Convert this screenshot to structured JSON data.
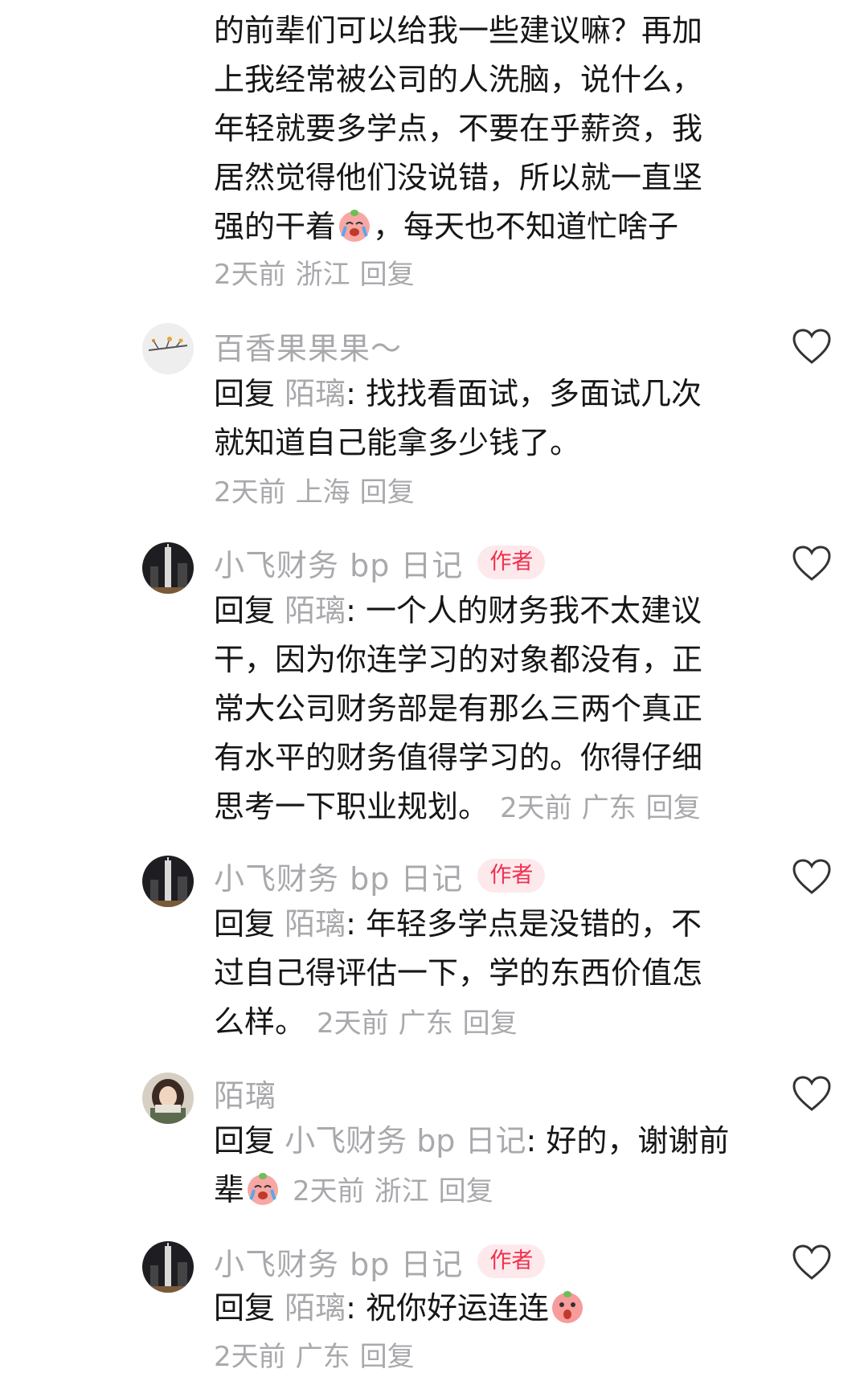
{
  "partial_comment": {
    "lines": [
      "的前辈们可以给我一些建议嘛？再加",
      "上我经常被公司的人洗脑，说什么，",
      "年轻就要多学点，不要在乎薪资，我",
      "居然觉得他们没说错，所以就一直坚",
      "强的干着"
    ],
    "emoji": "crying-emoji",
    "tail_text": "，每天也不知道忙啥子",
    "time": "2天前",
    "location": "浙江",
    "reply_label": "回复"
  },
  "comments": [
    {
      "name": "百香果果果～",
      "is_author": false,
      "reply_prefix": "回复",
      "reply_target": "陌璃",
      "lines": [
        "找找看面试，多面试几次",
        "就知道自己能拿多少钱了。"
      ],
      "time": "2天前",
      "location": "上海",
      "reply_label": "回复"
    },
    {
      "name": "小飞财务 bp 日记",
      "is_author": true,
      "author_badge": "作者",
      "reply_prefix": "回复",
      "reply_target": "陌璃",
      "lines": [
        "一个人的财务我不太建议",
        "干，因为你连学习的对象都没有，正",
        "常大公司财务部是有那么三两个真正",
        "有水平的财务值得学习的。你得仔细",
        "思考一下职业规划。"
      ],
      "time": "2天前",
      "location": "广东",
      "reply_label": "回复"
    },
    {
      "name": "小飞财务 bp 日记",
      "is_author": true,
      "author_badge": "作者",
      "reply_prefix": "回复",
      "reply_target": "陌璃",
      "lines": [
        "年轻多学点是没错的，不",
        "过自己得评估一下，学的东西价值怎",
        "么样。"
      ],
      "time": "2天前",
      "location": "广东",
      "reply_label": "回复"
    },
    {
      "name": "陌璃",
      "is_author": false,
      "reply_prefix": "回复",
      "reply_target": "小飞财务 bp 日记",
      "lines": [
        "好的，谢谢前",
        "辈"
      ],
      "emoji": "crying-emoji",
      "time": "2天前",
      "location": "浙江",
      "reply_label": "回复"
    },
    {
      "name": "小飞财务 bp 日记",
      "is_author": true,
      "author_badge": "作者",
      "reply_prefix": "回复",
      "reply_target": "陌璃",
      "lines": [
        "祝你好运连连"
      ],
      "emoji": "shocked-emoji",
      "time": "2天前",
      "location": "广东",
      "reply_label": "回复"
    }
  ],
  "icons": {
    "like": "heart-outline-icon"
  },
  "colors": {
    "text": "#161616",
    "muted": "#a9a9ad",
    "author_badge_bg": "#fde9ec",
    "author_badge_text": "#f0304f"
  }
}
